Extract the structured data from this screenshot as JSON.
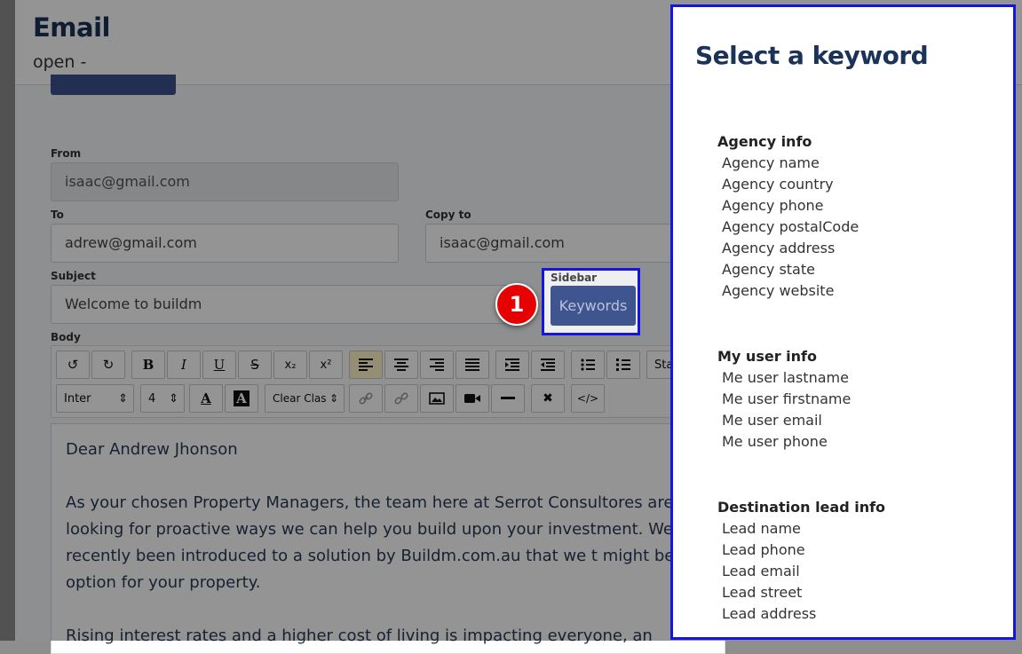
{
  "page": {
    "title": "Email",
    "subtitle": "open -",
    "from_label": "From",
    "from_value": "isaac@gmail.com",
    "to_label": "To",
    "to_value": "adrew@gmail.com",
    "copy_label": "Copy to",
    "copy_value": "isaac@gmail.com",
    "subject_label": "Subject",
    "subject_value": "Welcome to buildm",
    "sidebar_label": "Sidebar",
    "keywords_button": "Keywords",
    "body_label": "Body",
    "step_number": "1"
  },
  "toolbar": {
    "font": "Inter",
    "size": "4",
    "clear_class": "Clear Clas",
    "style_partial": "Sta",
    "bold": "B",
    "italic": "I",
    "underline": "U",
    "strike": "S",
    "sub": "x₂",
    "sup": "x²",
    "undo_icon": "↺",
    "redo_icon": "↻",
    "close_icon": "✖",
    "code_icon": "</>"
  },
  "editor": {
    "greeting": "Dear Andrew Jhonson",
    "para1": "As your chosen Property Managers, the team here at Serrot Consultores are looking for proactive ways we can help you build upon your investment. We’ve recently been introduced to a solution by Buildm.com.au that we t might be an option for your property.",
    "para2": "Rising interest rates and a higher cost of living is impacting everyone, an"
  },
  "sidebar": {
    "title": "Select a keyword",
    "groups": [
      {
        "heading": "Agency info",
        "items": [
          "Agency name",
          "Agency country",
          "Agency phone",
          "Agency postalCode",
          "Agency address",
          "Agency state",
          "Agency website"
        ]
      },
      {
        "heading": "My user info",
        "items": [
          "Me user lastname",
          "Me user firstname",
          "Me user email",
          "Me user phone"
        ]
      },
      {
        "heading": "Destination lead info",
        "items": [
          "Lead name",
          "Lead phone",
          "Lead email",
          "Lead street",
          "Lead address"
        ]
      }
    ]
  },
  "colors": {
    "brand_navy": "#1b3358",
    "button_blue": "#3f558f",
    "highlight_border": "#1515e0",
    "step_badge": "#e60000"
  }
}
